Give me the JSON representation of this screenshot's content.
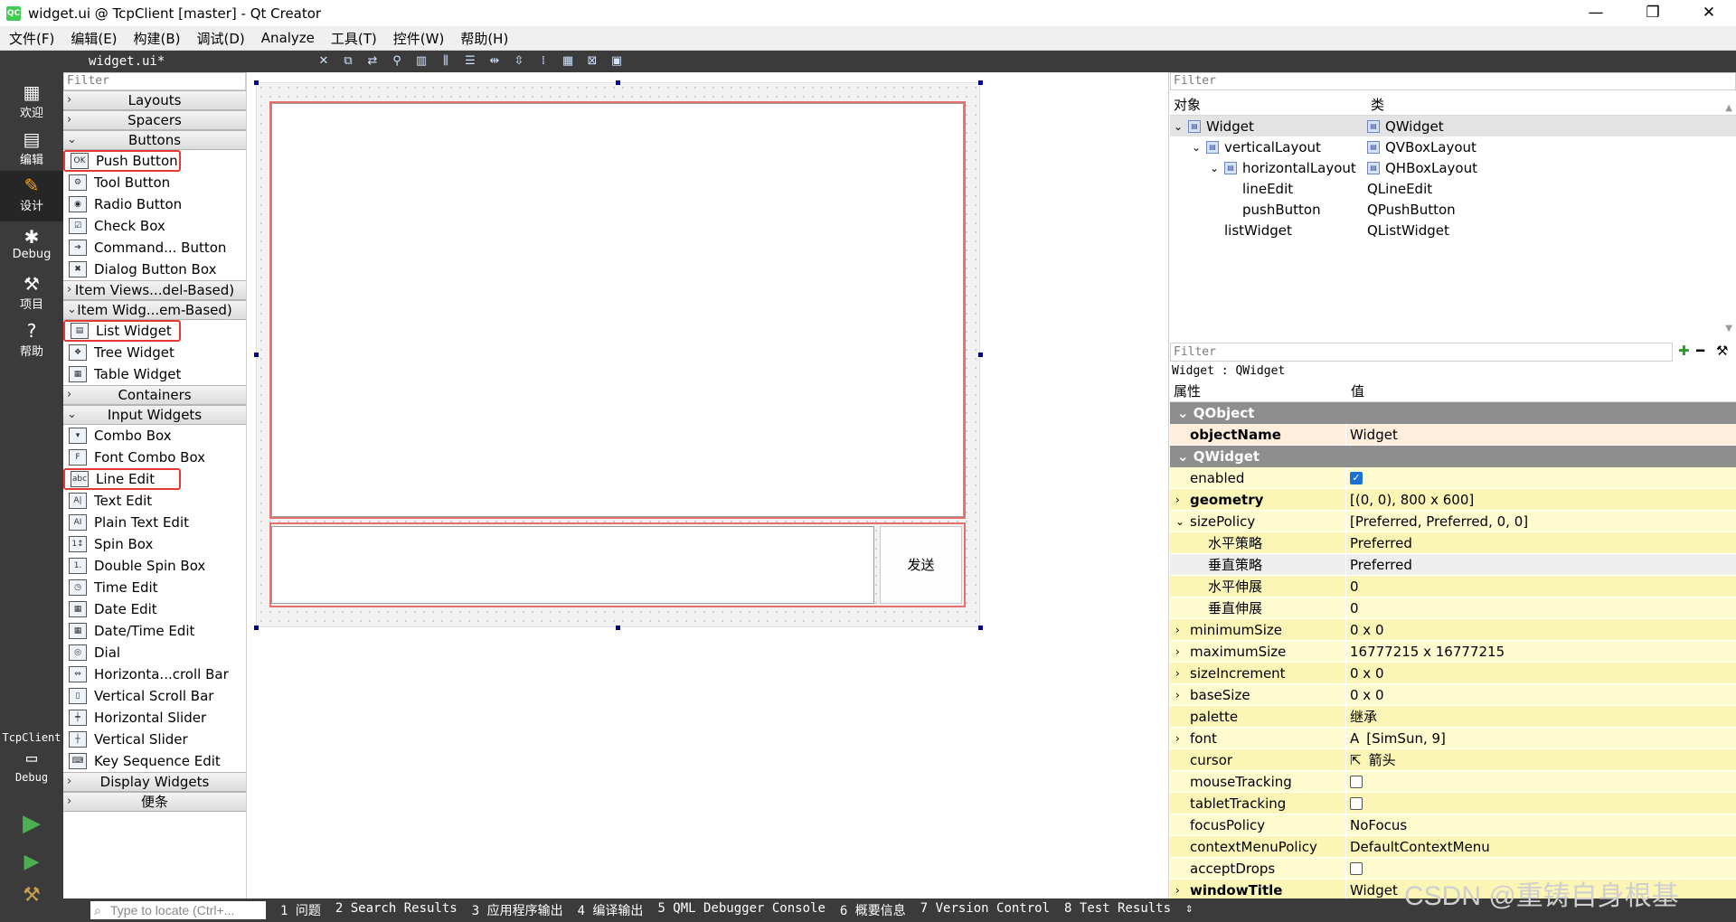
{
  "window": {
    "title": "widget.ui @ TcpClient [master] - Qt Creator",
    "app_icon": "QC",
    "minimize": "—",
    "maximize": "❐",
    "close": "✕"
  },
  "menu": [
    "文件(F)",
    "编辑(E)",
    "构建(B)",
    "调试(D)",
    "Analyze",
    "工具(T)",
    "控件(W)",
    "帮助(H)"
  ],
  "modes": [
    {
      "label": "欢迎",
      "icon": "grid-icon"
    },
    {
      "label": "编辑",
      "icon": "edit-icon"
    },
    {
      "label": "设计",
      "icon": "pen-icon"
    },
    {
      "label": "Debug",
      "icon": "bug-icon"
    },
    {
      "label": "项目",
      "icon": "wrench-icon"
    },
    {
      "label": "帮助",
      "icon": "help-icon"
    }
  ],
  "kit": {
    "project": "TcpClient",
    "mode": "Debug"
  },
  "editor_tab": "widget.ui*",
  "widget_box": {
    "filter": "Filter",
    "categories": [
      {
        "label": "Layouts",
        "open": false,
        "items": []
      },
      {
        "label": "Spacers",
        "open": false,
        "items": []
      },
      {
        "label": "Buttons",
        "open": true,
        "items": [
          {
            "label": "Push Button",
            "highlight": true
          },
          {
            "label": "Tool Button"
          },
          {
            "label": "Radio Button"
          },
          {
            "label": "Check Box"
          },
          {
            "label": "Command... Button"
          },
          {
            "label": "Dialog Button Box"
          }
        ]
      },
      {
        "label": "Item Views...del-Based)",
        "open": false,
        "items": []
      },
      {
        "label": "Item Widg...em-Based)",
        "open": true,
        "items": [
          {
            "label": "List Widget",
            "highlight": true
          },
          {
            "label": "Tree Widget"
          },
          {
            "label": "Table Widget"
          }
        ]
      },
      {
        "label": "Containers",
        "open": false,
        "items": []
      },
      {
        "label": "Input Widgets",
        "open": true,
        "items": [
          {
            "label": "Combo Box"
          },
          {
            "label": "Font Combo Box"
          },
          {
            "label": "Line Edit",
            "highlight": true
          },
          {
            "label": "Text Edit"
          },
          {
            "label": "Plain Text Edit"
          },
          {
            "label": "Spin Box"
          },
          {
            "label": "Double Spin Box"
          },
          {
            "label": "Time Edit"
          },
          {
            "label": "Date Edit"
          },
          {
            "label": "Date/Time Edit"
          },
          {
            "label": "Dial"
          },
          {
            "label": "Horizonta...croll Bar"
          },
          {
            "label": "Vertical Scroll Bar"
          },
          {
            "label": "Horizontal Slider"
          },
          {
            "label": "Vertical Slider"
          },
          {
            "label": "Key Sequence Edit"
          }
        ]
      },
      {
        "label": "Display Widgets",
        "open": false,
        "items": []
      },
      {
        "label": "便条",
        "open": false,
        "items": []
      }
    ]
  },
  "form": {
    "send_button": "发送"
  },
  "object_inspector": {
    "filter": "Filter",
    "col_object": "对象",
    "col_class": "类",
    "rows": [
      {
        "name": "Widget",
        "cls": "QWidget",
        "level": 0,
        "expander": "v",
        "selected": true
      },
      {
        "name": "verticalLayout",
        "cls": "QVBoxLayout",
        "level": 1,
        "expander": "v"
      },
      {
        "name": "horizontalLayout",
        "cls": "QHBoxLayout",
        "level": 2,
        "expander": "v"
      },
      {
        "name": "lineEdit",
        "cls": "QLineEdit",
        "level": 3
      },
      {
        "name": "pushButton",
        "cls": "QPushButton",
        "level": 3
      },
      {
        "name": "listWidget",
        "cls": "QListWidget",
        "level": 2
      }
    ]
  },
  "property_editor": {
    "filter": "Filter",
    "class_label": "Widget : QWidget",
    "col_prop": "属性",
    "col_value": "值",
    "groups": [
      {
        "name": "QObject",
        "rows": [
          {
            "name": "objectName",
            "value": "Widget",
            "bold": true,
            "style": "or"
          }
        ]
      },
      {
        "name": "QWidget",
        "rows": [
          {
            "name": "enabled",
            "check": true,
            "style": "y"
          },
          {
            "name": "geometry",
            "value": "[(0, 0), 800 x 600]",
            "bold": true,
            "expander": ">",
            "style": "y2"
          },
          {
            "name": "sizePolicy",
            "value": "[Preferred, Preferred, 0, 0]",
            "expander": "v",
            "style": "y"
          },
          {
            "name": "水平策略",
            "value": "Preferred",
            "sub": true,
            "style": "y2"
          },
          {
            "name": "垂直策略",
            "value": "Preferred",
            "sub": true,
            "style": "g"
          },
          {
            "name": "水平伸展",
            "value": "0",
            "sub": true,
            "style": "y2"
          },
          {
            "name": "垂直伸展",
            "value": "0",
            "sub": true,
            "style": "y"
          },
          {
            "name": "minimumSize",
            "value": "0 x 0",
            "expander": ">",
            "style": "y2"
          },
          {
            "name": "maximumSize",
            "value": "16777215 x 16777215",
            "expander": ">",
            "style": "y"
          },
          {
            "name": "sizeIncrement",
            "value": "0 x 0",
            "expander": ">",
            "style": "y2"
          },
          {
            "name": "baseSize",
            "value": "0 x 0",
            "expander": ">",
            "style": "y"
          },
          {
            "name": "palette",
            "value": "继承",
            "style": "y2"
          },
          {
            "name": "font",
            "value": "[SimSun, 9]",
            "expander": ">",
            "prefix": "A",
            "style": "y"
          },
          {
            "name": "cursor",
            "value": "箭头",
            "prefix": "⇱",
            "style": "y2"
          },
          {
            "name": "mouseTracking",
            "check": false,
            "style": "y"
          },
          {
            "name": "tabletTracking",
            "check": false,
            "style": "y2"
          },
          {
            "name": "focusPolicy",
            "value": "NoFocus",
            "style": "y"
          },
          {
            "name": "contextMenuPolicy",
            "value": "DefaultContextMenu",
            "style": "y2"
          },
          {
            "name": "acceptDrops",
            "check": false,
            "style": "y"
          },
          {
            "name": "windowTitle",
            "value": "Widget",
            "bold": true,
            "expander": ">",
            "style": "y2"
          }
        ]
      }
    ]
  },
  "statusbar": {
    "locator": "Type to locate (Ctrl+...",
    "tabs": [
      "1 问题",
      "2 Search Results",
      "3 应用程序输出",
      "4 编译输出",
      "5 QML Debugger Console",
      "6 概要信息",
      "7 Version Control",
      "8 Test Results"
    ]
  },
  "watermark": "CSDN @重铸自身根基"
}
